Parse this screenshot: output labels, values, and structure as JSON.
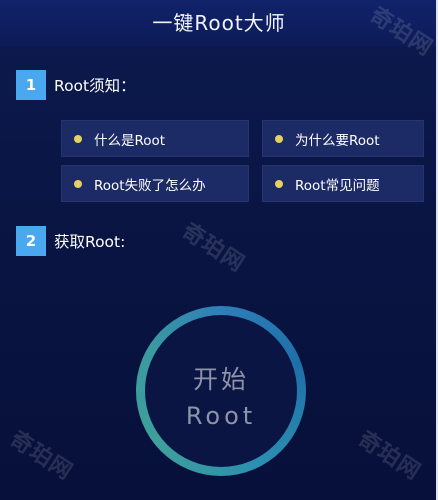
{
  "app": {
    "title": "一键Root大师"
  },
  "sections": [
    {
      "number": "1",
      "label": "Root须知："
    },
    {
      "number": "2",
      "label": "获取Root:"
    }
  ],
  "faq_items": [
    {
      "label": "什么是Root"
    },
    {
      "label": "为什么要Root"
    },
    {
      "label": "Root失败了怎么办"
    },
    {
      "label": "Root常见问题"
    }
  ],
  "start_button": {
    "line1": "开始",
    "line2": "Root"
  },
  "watermark": {
    "text": "奇珀网"
  },
  "colors": {
    "badge": "#4aa8f0",
    "bullet": "#e6d062",
    "faq_bg": "#1c2a66",
    "ring_blue": "#2e7fb8",
    "ring_teal": "#3f9f9a",
    "background": "#0a1544"
  }
}
